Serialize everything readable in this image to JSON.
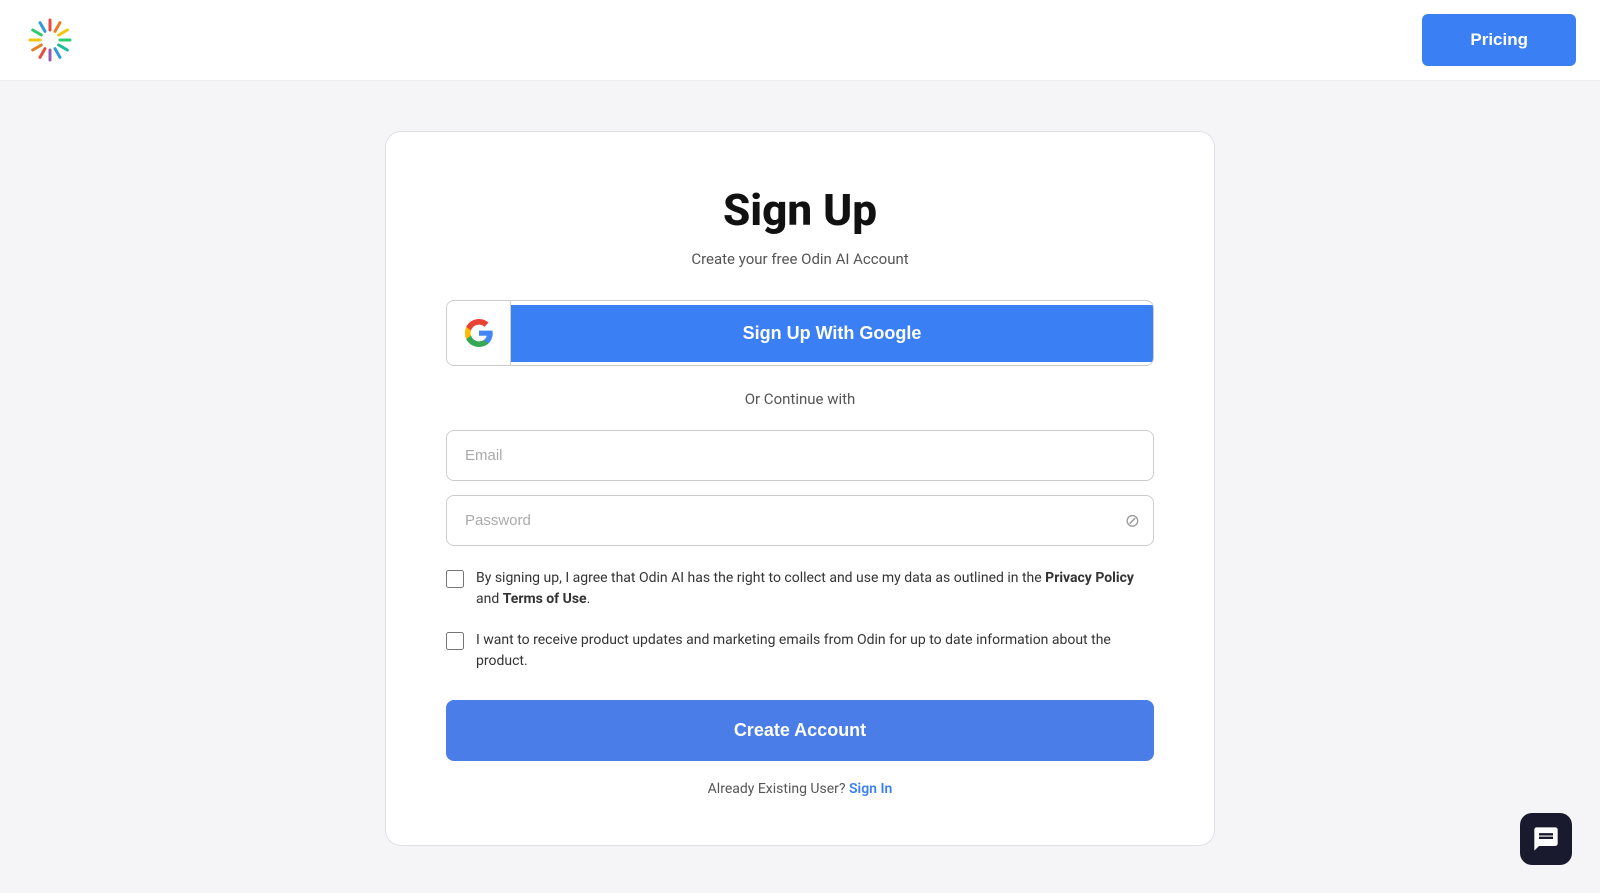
{
  "header": {
    "pricing_label": "Pricing",
    "logo_alt": "Odin AI Logo"
  },
  "form": {
    "title": "Sign Up",
    "subtitle": "Create your free Odin AI Account",
    "google_button_label": "Sign Up With Google",
    "divider_text": "Or Continue with",
    "email_placeholder": "Email",
    "password_placeholder": "Password",
    "checkbox1_text": "By signing up, I agree that Odin AI has the right to collect and use my data as outlined in the ",
    "checkbox1_link1": "Privacy Policy",
    "checkbox1_link1_connector": " and ",
    "checkbox1_link2": "Terms of Use",
    "checkbox1_end": ".",
    "checkbox2_text": "I want to receive product updates and marketing emails from Odin for up to date information about the product.",
    "create_account_label": "Create Account",
    "already_user_text": "Already Existing User?",
    "sign_in_label": "Sign In"
  },
  "colors": {
    "primary_blue": "#3b7ff5",
    "button_blue": "#4a7de8",
    "dark_bg": "#1a1a2e"
  }
}
